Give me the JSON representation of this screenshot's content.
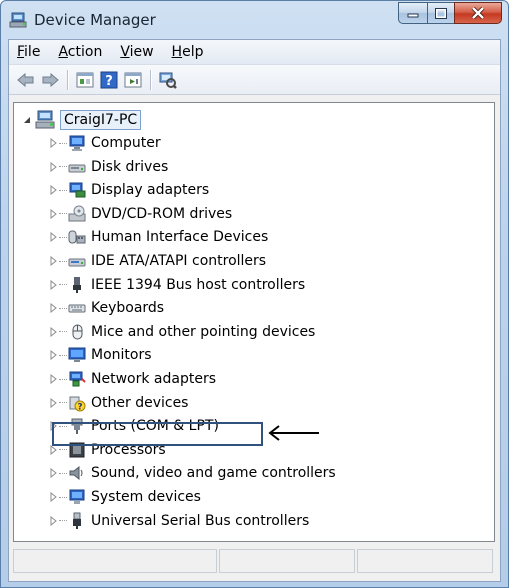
{
  "window": {
    "title": "Device Manager"
  },
  "menu": [
    {
      "label": "File",
      "key": "F",
      "rest": "ile"
    },
    {
      "label": "Action",
      "key": "A",
      "rest": "ction"
    },
    {
      "label": "View",
      "key": "V",
      "rest": "iew"
    },
    {
      "label": "Help",
      "key": "H",
      "rest": "elp"
    }
  ],
  "toolbar": {
    "icons": [
      "back-arrow-icon",
      "forward-arrow-icon",
      "properties-icon",
      "help-icon",
      "update-view-icon",
      "scan-hardware-icon"
    ]
  },
  "tree": {
    "root": "CraigI7-PC",
    "items": [
      {
        "label": "Computer",
        "icon": "computer-icon"
      },
      {
        "label": "Disk drives",
        "icon": "disk-drive-icon"
      },
      {
        "label": "Display adapters",
        "icon": "display-adapter-icon"
      },
      {
        "label": "DVD/CD-ROM drives",
        "icon": "dvd-drive-icon"
      },
      {
        "label": "Human Interface Devices",
        "icon": "hid-icon"
      },
      {
        "label": "IDE ATA/ATAPI controllers",
        "icon": "ide-controller-icon"
      },
      {
        "label": "IEEE 1394 Bus host controllers",
        "icon": "ieee1394-icon"
      },
      {
        "label": "Keyboards",
        "icon": "keyboard-icon"
      },
      {
        "label": "Mice and other pointing devices",
        "icon": "mouse-icon"
      },
      {
        "label": "Monitors",
        "icon": "monitor-icon"
      },
      {
        "label": "Network adapters",
        "icon": "network-adapter-icon"
      },
      {
        "label": "Other devices",
        "icon": "unknown-device-icon"
      },
      {
        "label": "Ports (COM & LPT)",
        "icon": "port-icon"
      },
      {
        "label": "Processors",
        "icon": "processor-icon"
      },
      {
        "label": "Sound, video and game controllers",
        "icon": "sound-icon"
      },
      {
        "label": "System devices",
        "icon": "system-devices-icon"
      },
      {
        "label": "Universal Serial Bus controllers",
        "icon": "usb-icon"
      }
    ]
  },
  "colors": {
    "highlight_border": "#2f527e",
    "titlebar": "#bcd3ec",
    "close_button": "#c4391f"
  }
}
